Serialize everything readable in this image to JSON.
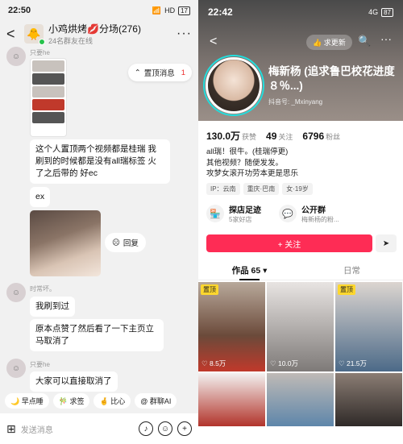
{
  "chat": {
    "status": {
      "time": "22:50",
      "network": "HD",
      "battery": "17"
    },
    "header": {
      "back": "<",
      "title": "小鸡烘烤💋分场(276)",
      "subtitle": "24名群友在线",
      "more": "···"
    },
    "pinned": {
      "label": "置顶消息",
      "count": "1"
    },
    "messages": [
      {
        "sender": "只要he"
      },
      {
        "text": "这个人置顶两个视频都是桂瑞 我刷到的时候都是没有all瑞标签 火了之后带的 好ec"
      },
      {
        "text": "ex"
      },
      {
        "reply_label": "回复"
      },
      {
        "sender": "时常坏。"
      },
      {
        "text": "我刷到过"
      },
      {
        "text": "原本点赞了然后看了一下主页立马取消了"
      },
      {
        "sender": "只要he"
      },
      {
        "text": "大家可以直接取消了"
      }
    ],
    "chips": [
      "早点睡",
      "求签",
      "比心",
      "群聊AI"
    ],
    "input_placeholder": "发送消息"
  },
  "profile": {
    "status": {
      "time": "22:42",
      "network": "4G",
      "battery": "87"
    },
    "visit_label": "求更新",
    "nickname": "梅新杨 (追求鲁巴校花进度８％...)",
    "handle": "抖音号: _Mxinyang",
    "stats": [
      {
        "value": "130.0万",
        "label": "获赞"
      },
      {
        "value": "49",
        "label": "关注"
      },
      {
        "value": "6796",
        "label": "粉丝"
      }
    ],
    "bio": [
      "all瑞！很牛。(桂瑞停更)",
      "其他视频？随便发发。",
      "攻梦女滚开功劳本更是思乐"
    ],
    "tags": [
      "IP：云南",
      "重庆·巴南",
      "女·19岁"
    ],
    "shop": {
      "title": "探店足迹",
      "sub": "5家好店"
    },
    "group": {
      "title": "公开群",
      "sub": "梅新杨的粉..."
    },
    "follow_label": "+ 关注",
    "tabs": [
      "作品 65 ▾",
      "日常"
    ],
    "videos": [
      {
        "badge": "置顶",
        "views": "8.5万"
      },
      {
        "badge": "",
        "views": "10.0万"
      },
      {
        "badge": "置顶",
        "views": "21.5万"
      },
      {
        "badge": "",
        "views": ""
      },
      {
        "badge": "",
        "views": ""
      },
      {
        "badge": "",
        "views": ""
      }
    ],
    "accent": "#fe2c55"
  }
}
